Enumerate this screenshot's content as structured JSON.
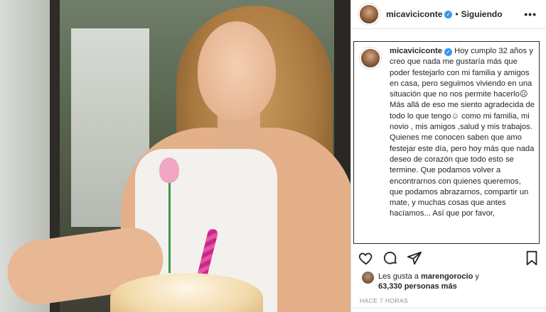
{
  "header": {
    "username": "micaviciconte",
    "verified_mark": "✓",
    "separator": "•",
    "follow_status": "Siguiendo",
    "more": "•••"
  },
  "caption": {
    "username": "micaviciconte",
    "lines": [
      "Hoy cumplo 32 años y creo que nada me gustaría más que poder festejarlo con mi familia y amigos en casa, pero seguimos viviendo en una situación que no nos permite hacerlo☹",
      "Más allá de eso me siento agradecida de todo lo que tengo☺ como mi familia, mi novio , mis amigos ,salud y mis trabajos.",
      "Quienes me conocen saben que amo festejar este día, pero hoy más que nada deseo de corazón que todo esto se termine. Que podamos volver a encontrarnos con quienes queremos, que podamos abrazarnos, compartir un mate, y muchas cosas que antes hacíamos... Así que por favor,"
    ]
  },
  "likes": {
    "prefix": "Les gusta a",
    "liker": "marengorocio",
    "conjunction": "y",
    "count_text": "63,330 personas más"
  },
  "timestamp": "HACE 7 HORAS",
  "icons": {
    "like": "heart-icon",
    "comment": "comment-icon",
    "share": "share-icon",
    "save": "bookmark-icon",
    "more": "more-icon"
  },
  "colors": {
    "verified": "#3897f0",
    "text": "#262626",
    "muted": "#8e8e8e"
  }
}
